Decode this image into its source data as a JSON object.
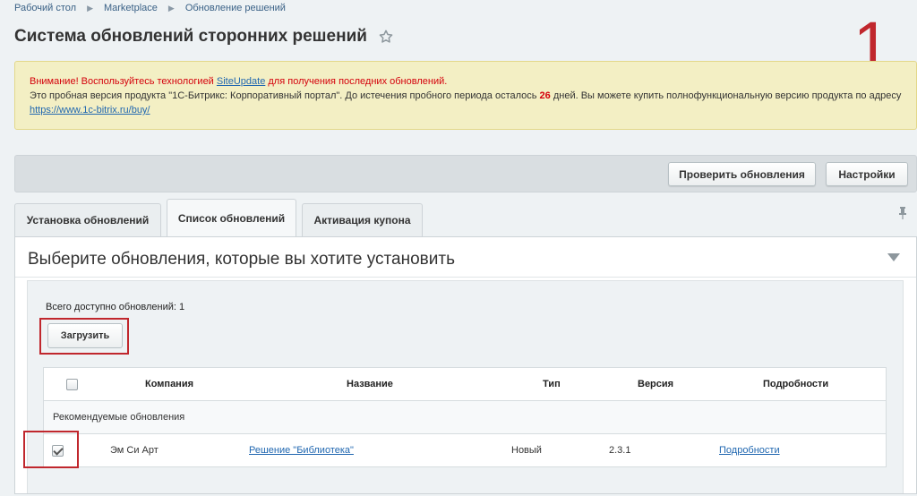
{
  "breadcrumb": [
    "Рабочий стол",
    "Marketplace",
    "Обновление решений"
  ],
  "page": {
    "title": "Система обновлений сторонних решений",
    "annotation": "1"
  },
  "notice": {
    "warning_prefix": "Внимание! Воспользуйтесь технологией ",
    "warning_link": "SiteUpdate",
    "warning_suffix": " для получения последних обновлений.",
    "trial_text": "Это пробная версия продукта \"1С-Битрикс: Корпоративный портал\". До истечения пробного периода осталось ",
    "days": "26",
    "trial_text_2": " дней. Вы можете купить полнофункциональную версию продукта по адресу ",
    "buy_link": "https://www.1c-bitrix.ru/buy/"
  },
  "toolbar": {
    "check_label": "Проверить обновления",
    "settings_label": "Настройки"
  },
  "tabs": [
    {
      "label": "Установка обновлений",
      "active": false
    },
    {
      "label": "Список обновлений",
      "active": true
    },
    {
      "label": "Активация купона",
      "active": false
    }
  ],
  "panel": {
    "title": "Выберите обновления, которые вы хотите установить",
    "total": "Всего доступно обновлений: 1",
    "load_label": "Загрузить"
  },
  "table": {
    "columns": [
      "Компания",
      "Название",
      "Тип",
      "Версия",
      "Подробности"
    ],
    "group_label": "Рекомендуемые обновления",
    "rows": [
      {
        "company": "Эм Си Арт",
        "name": "Решение \"Библиотека\"",
        "type": "Новый",
        "version": "2.3.1",
        "details": "Подробности",
        "checked": true
      }
    ]
  },
  "colors": {
    "accent": "#c0272d",
    "link": "#2067b0",
    "warning": "#d4000b",
    "notice_bg": "#f3efc4"
  },
  "icons": {
    "title": "star-icon",
    "pin": "pin-icon",
    "collapse": "chevron-down-icon"
  }
}
